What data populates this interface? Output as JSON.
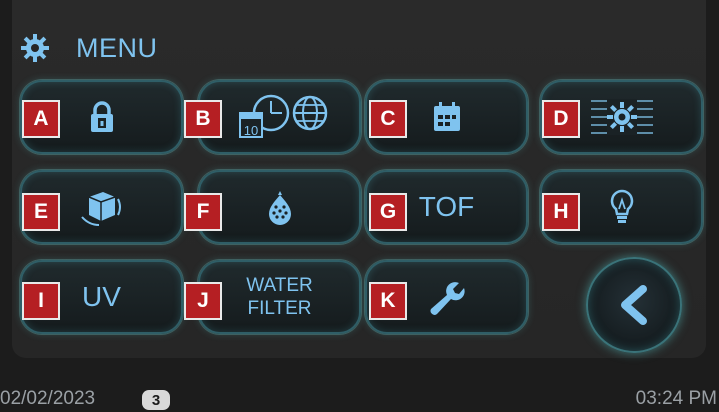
{
  "header": {
    "title": "MENU",
    "icon": "gear-icon"
  },
  "colors": {
    "accent": "#7fc3ef",
    "tag_red": "#b51f23",
    "glow": "#3a8a8f",
    "background": "#1c1c1c"
  },
  "buttons": [
    {
      "tag": "A",
      "icon": "lock-icon"
    },
    {
      "tag": "B",
      "icon": "clock-calendar-globe-icon",
      "day": "10"
    },
    {
      "tag": "C",
      "icon": "calendar-icon"
    },
    {
      "tag": "D",
      "icon": "brightness-lines-icon"
    },
    {
      "tag": "E",
      "icon": "ice-cube-icon"
    },
    {
      "tag": "F",
      "icon": "nutrient-drop-icon"
    },
    {
      "tag": "G",
      "label": "TOF"
    },
    {
      "tag": "H",
      "icon": "lightbulb-icon"
    },
    {
      "tag": "I",
      "label": "UV"
    },
    {
      "tag": "J",
      "label_line1": "WATER",
      "label_line2": "FILTER"
    },
    {
      "tag": "K",
      "icon": "wrench-icon"
    }
  ],
  "back_button": {
    "icon": "chevron-left-icon"
  },
  "footer": {
    "date": "02/02/2023",
    "badge": "3",
    "time": "03:24 PM"
  }
}
